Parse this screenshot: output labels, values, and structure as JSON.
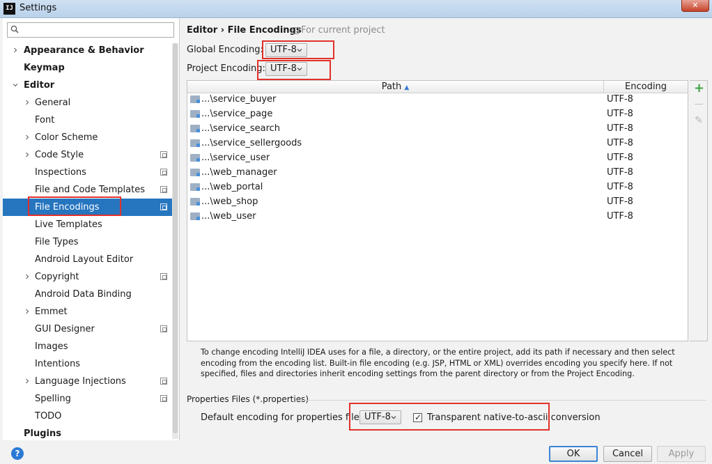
{
  "window": {
    "app_icon": "IJ",
    "title": "Settings",
    "close_label": "✕"
  },
  "search": {
    "placeholder": "",
    "value": ""
  },
  "tree": [
    {
      "label": "Appearance & Behavior",
      "bold": true,
      "expandable": true,
      "expanded": false,
      "indent": 0,
      "project_icon": false,
      "selected": false
    },
    {
      "label": "Keymap",
      "bold": true,
      "expandable": false,
      "expanded": false,
      "indent": 0,
      "project_icon": false,
      "selected": false
    },
    {
      "label": "Editor",
      "bold": true,
      "expandable": true,
      "expanded": true,
      "indent": 0,
      "project_icon": false,
      "selected": false
    },
    {
      "label": "General",
      "bold": false,
      "expandable": true,
      "expanded": false,
      "indent": 1,
      "project_icon": false,
      "selected": false
    },
    {
      "label": "Font",
      "bold": false,
      "expandable": false,
      "expanded": false,
      "indent": 1,
      "project_icon": false,
      "selected": false
    },
    {
      "label": "Color Scheme",
      "bold": false,
      "expandable": true,
      "expanded": false,
      "indent": 1,
      "project_icon": false,
      "selected": false
    },
    {
      "label": "Code Style",
      "bold": false,
      "expandable": true,
      "expanded": false,
      "indent": 1,
      "project_icon": true,
      "selected": false
    },
    {
      "label": "Inspections",
      "bold": false,
      "expandable": false,
      "expanded": false,
      "indent": 1,
      "project_icon": true,
      "selected": false
    },
    {
      "label": "File and Code Templates",
      "bold": false,
      "expandable": false,
      "expanded": false,
      "indent": 1,
      "project_icon": true,
      "selected": false
    },
    {
      "label": "File Encodings",
      "bold": false,
      "expandable": false,
      "expanded": false,
      "indent": 1,
      "project_icon": true,
      "selected": true
    },
    {
      "label": "Live Templates",
      "bold": false,
      "expandable": false,
      "expanded": false,
      "indent": 1,
      "project_icon": false,
      "selected": false
    },
    {
      "label": "File Types",
      "bold": false,
      "expandable": false,
      "expanded": false,
      "indent": 1,
      "project_icon": false,
      "selected": false
    },
    {
      "label": "Android Layout Editor",
      "bold": false,
      "expandable": false,
      "expanded": false,
      "indent": 1,
      "project_icon": false,
      "selected": false
    },
    {
      "label": "Copyright",
      "bold": false,
      "expandable": true,
      "expanded": false,
      "indent": 1,
      "project_icon": true,
      "selected": false
    },
    {
      "label": "Android Data Binding",
      "bold": false,
      "expandable": false,
      "expanded": false,
      "indent": 1,
      "project_icon": false,
      "selected": false
    },
    {
      "label": "Emmet",
      "bold": false,
      "expandable": true,
      "expanded": false,
      "indent": 1,
      "project_icon": false,
      "selected": false
    },
    {
      "label": "GUI Designer",
      "bold": false,
      "expandable": false,
      "expanded": false,
      "indent": 1,
      "project_icon": true,
      "selected": false
    },
    {
      "label": "Images",
      "bold": false,
      "expandable": false,
      "expanded": false,
      "indent": 1,
      "project_icon": false,
      "selected": false
    },
    {
      "label": "Intentions",
      "bold": false,
      "expandable": false,
      "expanded": false,
      "indent": 1,
      "project_icon": false,
      "selected": false
    },
    {
      "label": "Language Injections",
      "bold": false,
      "expandable": true,
      "expanded": false,
      "indent": 1,
      "project_icon": true,
      "selected": false
    },
    {
      "label": "Spelling",
      "bold": false,
      "expandable": false,
      "expanded": false,
      "indent": 1,
      "project_icon": true,
      "selected": false
    },
    {
      "label": "TODO",
      "bold": false,
      "expandable": false,
      "expanded": false,
      "indent": 1,
      "project_icon": false,
      "selected": false
    },
    {
      "label": "Plugins",
      "bold": true,
      "expandable": false,
      "expanded": false,
      "indent": 0,
      "project_icon": false,
      "selected": false
    }
  ],
  "panel": {
    "breadcrumb": "Editor › File Encodings",
    "scope_note": "For current project",
    "global_encoding_label": "Global Encoding:",
    "global_encoding_value": "UTF-8",
    "project_encoding_label": "Project Encoding:",
    "project_encoding_value": "UTF-8"
  },
  "table": {
    "col_path": "Path",
    "col_path_sort": "▲",
    "col_encoding": "Encoding",
    "rows": [
      {
        "path": "...\\service_buyer",
        "encoding": "UTF-8"
      },
      {
        "path": "...\\service_page",
        "encoding": "UTF-8"
      },
      {
        "path": "...\\service_search",
        "encoding": "UTF-8"
      },
      {
        "path": "...\\service_sellergoods",
        "encoding": "UTF-8"
      },
      {
        "path": "...\\service_user",
        "encoding": "UTF-8"
      },
      {
        "path": "...\\web_manager",
        "encoding": "UTF-8"
      },
      {
        "path": "...\\web_portal",
        "encoding": "UTF-8"
      },
      {
        "path": "...\\web_shop",
        "encoding": "UTF-8"
      },
      {
        "path": "...\\web_user",
        "encoding": "UTF-8"
      }
    ],
    "tools": {
      "add": "+",
      "remove": "—",
      "edit": "✎"
    }
  },
  "hint": "To change encoding IntelliJ IDEA uses for a file, a directory, or the entire project, add its path if necessary and then select encoding from the encoding list. Built-in file encoding (e.g. JSP, HTML or XML) overrides encoding you specify here. If not specified, files and directories inherit encoding settings from the parent directory or from the Project Encoding.",
  "properties": {
    "section_title": "Properties Files (*.properties)",
    "default_label": "Default encoding for properties files:",
    "default_value": "UTF-8",
    "native_ascii_label": "Transparent native-to-ascii conversion",
    "native_ascii_checked": true
  },
  "buttons": {
    "help": "?",
    "ok": "OK",
    "cancel": "Cancel",
    "apply": "Apply"
  },
  "colors": {
    "selection": "#2675bf",
    "highlight_box": "#e2302a",
    "add_green": "#3fa33f"
  },
  "icons": {
    "search": "search-icon",
    "folder": "folder-icon",
    "project_scope": "project-scope-icon",
    "expand": "chevron-right-icon",
    "collapse": "chevron-down-icon"
  }
}
